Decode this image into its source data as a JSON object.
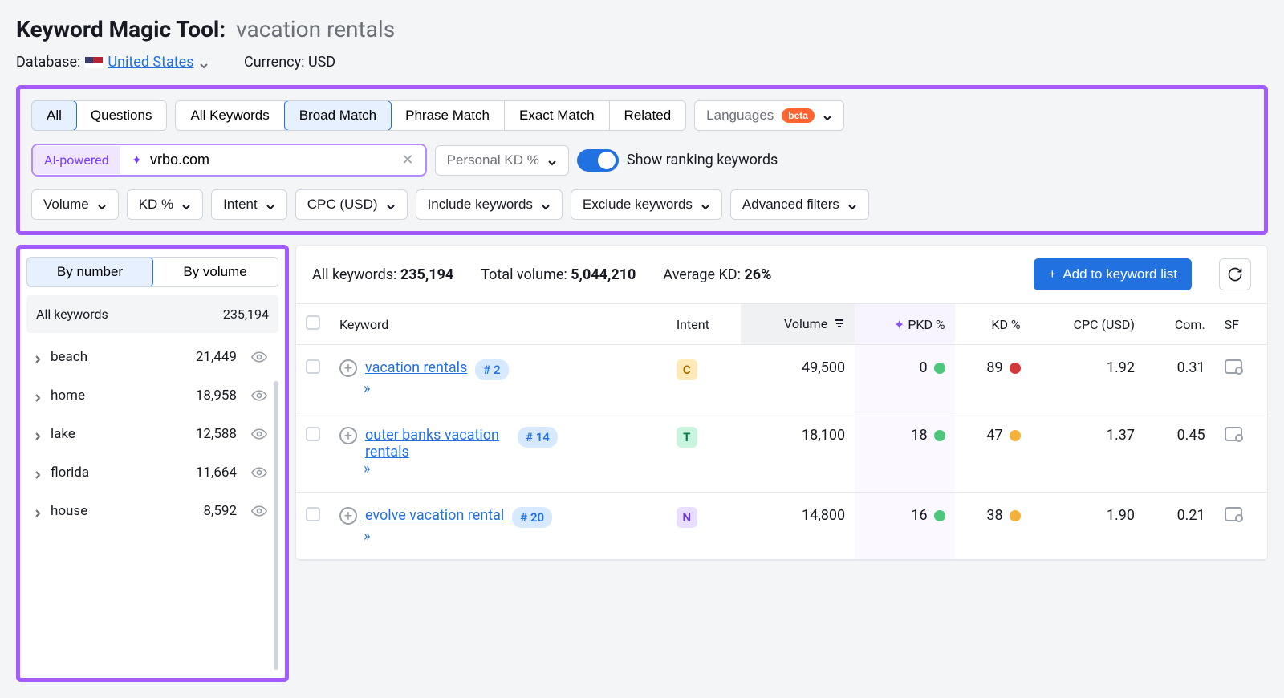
{
  "header": {
    "tool_name": "Keyword Magic Tool:",
    "query": "vacation rentals",
    "database_label": "Database:",
    "database_country": "United States",
    "currency_label": "Currency:",
    "currency_value": "USD"
  },
  "filters": {
    "type_tabs": [
      "All",
      "Questions"
    ],
    "type_tabs_active": 0,
    "match_tabs": [
      "All Keywords",
      "Broad Match",
      "Phrase Match",
      "Exact Match",
      "Related"
    ],
    "match_tabs_active": 1,
    "languages_label": "Languages",
    "languages_badge": "beta",
    "ai_badge": "AI-powered",
    "domain_value": "vrbo.com",
    "personal_kd_label": "Personal KD %",
    "ranking_toggle_label": "Show ranking keywords",
    "ranking_toggle_on": true,
    "filter_buttons": [
      "Volume",
      "KD %",
      "Intent",
      "CPC (USD)",
      "Include keywords",
      "Exclude keywords",
      "Advanced filters"
    ]
  },
  "sidebar": {
    "sort_tabs": [
      "By number",
      "By volume"
    ],
    "sort_active": 0,
    "all_label": "All keywords",
    "all_count": "235,194",
    "items": [
      {
        "label": "beach",
        "count": "21,449"
      },
      {
        "label": "home",
        "count": "18,958"
      },
      {
        "label": "lake",
        "count": "12,588"
      },
      {
        "label": "florida",
        "count": "11,664"
      },
      {
        "label": "house",
        "count": "8,592"
      }
    ]
  },
  "stats": {
    "all_keywords_label": "All keywords:",
    "all_keywords_value": "235,194",
    "total_volume_label": "Total volume:",
    "total_volume_value": "5,044,210",
    "avg_kd_label": "Average KD:",
    "avg_kd_value": "26%",
    "add_button": "Add to keyword list"
  },
  "table": {
    "columns": {
      "keyword": "Keyword",
      "intent": "Intent",
      "volume": "Volume",
      "pkd": "PKD %",
      "kd": "KD %",
      "cpc": "CPC (USD)",
      "com": "Com.",
      "sf": "SF"
    },
    "rows": [
      {
        "keyword": "vacation rentals",
        "rank": "# 2",
        "intent": "C",
        "volume": "49,500",
        "pkd": "0",
        "pkd_color": "green",
        "kd": "89",
        "kd_color": "red",
        "cpc": "1.92",
        "com": "0.31"
      },
      {
        "keyword": "outer banks vacation rentals",
        "rank": "# 14",
        "intent": "T",
        "volume": "18,100",
        "pkd": "18",
        "pkd_color": "green",
        "kd": "47",
        "kd_color": "orange",
        "cpc": "1.37",
        "com": "0.45"
      },
      {
        "keyword": "evolve vacation rental",
        "rank": "# 20",
        "intent": "N",
        "volume": "14,800",
        "pkd": "16",
        "pkd_color": "green",
        "kd": "38",
        "kd_color": "orange",
        "cpc": "1.90",
        "com": "0.21"
      }
    ]
  }
}
